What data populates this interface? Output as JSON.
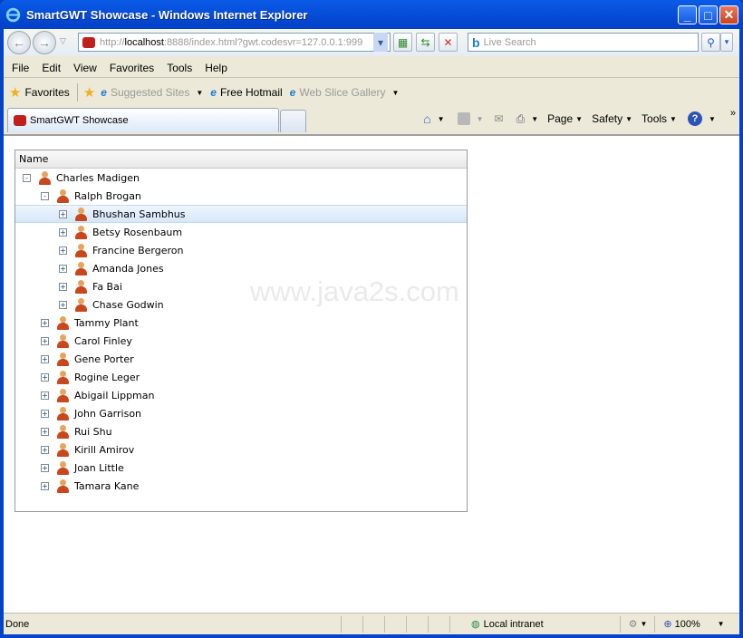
{
  "window": {
    "title": "SmartGWT Showcase - Windows Internet Explorer"
  },
  "address": {
    "prefix": "http://",
    "host": "localhost",
    "rest": ":8888/index.html?gwt.codesvr=127.0.0.1:999"
  },
  "search": {
    "placeholder": "Live Search"
  },
  "menu": [
    "File",
    "Edit",
    "View",
    "Favorites",
    "Tools",
    "Help"
  ],
  "favorites": {
    "label": "Favorites",
    "items": [
      "Suggested Sites",
      "Free Hotmail",
      "Web Slice Gallery"
    ]
  },
  "tab": {
    "label": "SmartGWT Showcase"
  },
  "commands": [
    "Page",
    "Safety",
    "Tools"
  ],
  "grid": {
    "header": "Name",
    "rows": [
      {
        "name": "Charles Madigen",
        "level": 0,
        "state": "-"
      },
      {
        "name": "Ralph Brogan",
        "level": 1,
        "state": "-"
      },
      {
        "name": "Bhushan Sambhus",
        "level": 2,
        "state": "+",
        "selected": true
      },
      {
        "name": "Betsy Rosenbaum",
        "level": 2,
        "state": "+"
      },
      {
        "name": "Francine Bergeron",
        "level": 2,
        "state": "+"
      },
      {
        "name": "Amanda Jones",
        "level": 2,
        "state": "+"
      },
      {
        "name": "Fa Bai",
        "level": 2,
        "state": "+"
      },
      {
        "name": "Chase Godwin",
        "level": 2,
        "state": "+"
      },
      {
        "name": "Tammy Plant",
        "level": 1,
        "state": "+"
      },
      {
        "name": "Carol Finley",
        "level": 1,
        "state": "+"
      },
      {
        "name": "Gene Porter",
        "level": 1,
        "state": "+"
      },
      {
        "name": "Rogine Leger",
        "level": 1,
        "state": "+"
      },
      {
        "name": "Abigail Lippman",
        "level": 1,
        "state": "+"
      },
      {
        "name": "John Garrison",
        "level": 1,
        "state": "+"
      },
      {
        "name": "Rui Shu",
        "level": 1,
        "state": "+"
      },
      {
        "name": "Kirill Amirov",
        "level": 1,
        "state": "+"
      },
      {
        "name": "Joan Little",
        "level": 1,
        "state": "+"
      },
      {
        "name": "Tamara Kane",
        "level": 1,
        "state": "+"
      }
    ]
  },
  "watermark": "www.java2s.com",
  "status": {
    "text": "Done",
    "zone": "Local intranet",
    "zoom": "100%"
  }
}
